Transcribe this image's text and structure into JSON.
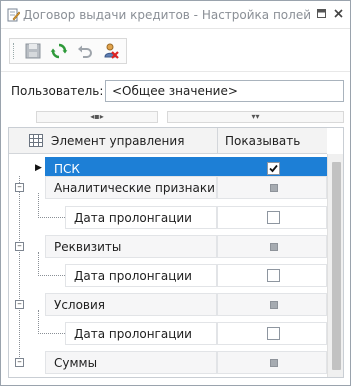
{
  "window": {
    "title": "Договор выдачи кредитов - Настройка полей",
    "pin_icon": "pin-icon",
    "close_icon": "close-icon"
  },
  "toolbar": {
    "buttons": [
      {
        "name": "save-icon",
        "enabled": false
      },
      {
        "name": "refresh-icon",
        "enabled": true
      },
      {
        "name": "undo-icon",
        "enabled": false
      },
      {
        "name": "clear-settings-icon",
        "enabled": true
      }
    ]
  },
  "user": {
    "label": "Пользователь:",
    "value": "<Общее значение>"
  },
  "ruler": {
    "left_marker": "◂▪▸",
    "right_marker": "▾▾"
  },
  "grid": {
    "columns": [
      "Элемент управления",
      "Показывать"
    ],
    "rows": [
      {
        "label": "ПСК",
        "level": 0,
        "checked": true,
        "state": "checked",
        "selected": true
      },
      {
        "label": "Аналитические признаки",
        "level": 0,
        "state": "indeterminate",
        "expanded": true
      },
      {
        "label": "Дата пролонгации",
        "level": 1,
        "state": "unchecked"
      },
      {
        "label": "Реквизиты",
        "level": 0,
        "state": "indeterminate",
        "expanded": true
      },
      {
        "label": "Дата пролонгации",
        "level": 1,
        "state": "unchecked"
      },
      {
        "label": "Условия",
        "level": 0,
        "state": "indeterminate",
        "expanded": true
      },
      {
        "label": "Дата пролонгации",
        "level": 1,
        "state": "unchecked"
      },
      {
        "label": "Суммы",
        "level": 0,
        "state": "indeterminate",
        "expanded": true
      }
    ]
  },
  "colors": {
    "selection": "#1d7fd6",
    "refresh_green": "#2e9a3a"
  }
}
